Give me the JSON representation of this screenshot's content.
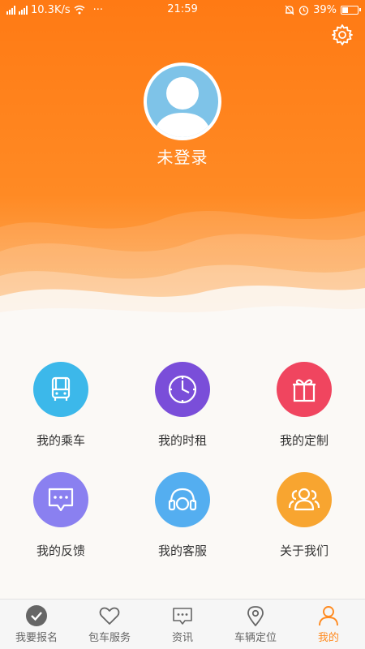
{
  "status": {
    "network_speed": "10.3K/s",
    "dots": "···",
    "time": "21:59",
    "battery": "39%",
    "battery_level": 0.39
  },
  "profile": {
    "login_label": "未登录"
  },
  "menu": {
    "items": [
      {
        "label": "我的乘车",
        "icon": "bus-icon",
        "color": "#3cb8ea"
      },
      {
        "label": "我的时租",
        "icon": "clock-icon",
        "color": "#7a4ed9"
      },
      {
        "label": "我的定制",
        "icon": "gift-icon",
        "color": "#f0455f"
      },
      {
        "label": "我的反馈",
        "icon": "chat-icon",
        "color": "#8a80f0"
      },
      {
        "label": "我的客服",
        "icon": "headphones-icon",
        "color": "#54aef0"
      },
      {
        "label": "关于我们",
        "icon": "people-icon",
        "color": "#f8a530"
      }
    ]
  },
  "tabs": [
    {
      "label": "我要报名",
      "icon": "check-circle-icon"
    },
    {
      "label": "包车服务",
      "icon": "heart-icon"
    },
    {
      "label": "资讯",
      "icon": "message-icon"
    },
    {
      "label": "车辆定位",
      "icon": "location-pin-icon"
    },
    {
      "label": "我的",
      "icon": "person-icon",
      "active": true
    }
  ],
  "colors": {
    "accent": "#ff8a1f",
    "header": "#ff7a14"
  }
}
